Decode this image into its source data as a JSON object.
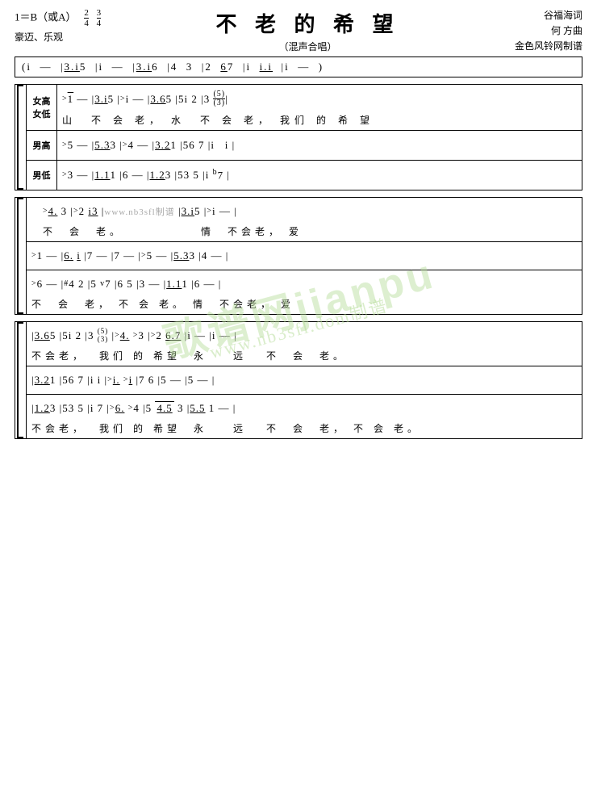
{
  "title": "不 老 的 希 望",
  "subtitle": "（混声合唱）",
  "key": "1＝B（或A）",
  "time": "2/4",
  "time2": "3/4",
  "style": "豪迈、乐观",
  "composer": {
    "lyrics": "谷福海词",
    "music": "何 方曲",
    "notation": "金色风铃网制谱"
  },
  "watermark": "歌谱网jianpu.cn",
  "watermark2": "www.nb3sfl.dom制谱",
  "intro": "(i  —  |3.i5  |i  —  |3.i6  |4  3  |2  67  |i  i.i  |i  —  )",
  "sections": {
    "s1": {
      "parts": [
        {
          "label1": "女高",
          "label2": "女低",
          "notes": ">1  —  |3.i5  |>i  —  |3.65  |5i  2  |3  (5/3)|",
          "lyrics": "山      不 会 老，  水      不 会 老，  我们  的  希  望"
        },
        {
          "label1": "男高",
          "label2": "",
          "notes": ">5  —  |5.33  |>4  —  |3.21  |56  7  |i      i  |",
          "lyrics": ""
        },
        {
          "label1": "男低",
          "label2": "",
          "notes": ">3  —  |1.11  |6  —  |1.23  |53  5  |i  b7  |",
          "lyrics": ""
        }
      ]
    },
    "s2": {
      "rows": [
        {
          "notes_row1": ">4.  3  |>2  i3  |www.nb3sfl.dom制谱  |3.i5  |>i  —  |",
          "lyrics_row1": "不      会      老。              情      不会老，  爱",
          "notes_row2": ">1  —  |6.  i  |7  —  |7  —  |>5  —  |5.33  |4  —  |",
          "lyrics_row2": "",
          "notes_row3": ">6  —  |#4  2  |5  v7  |6  5  |3  —  |1.11  |6  —  |",
          "lyrics_row3": "不      会      老，  不  会  老。  情      不会老，  爱"
        }
      ]
    },
    "s3": {
      "rows": [
        {
          "notes_row1": "|3.65  |5i  2  |3  (5/3)|>4.  >3  |>2  6.7  |i  —  |i  —  |",
          "lyrics_row1": "不会老，  我们  的  希望  永      远    不    会    老。",
          "notes_row2": "|3.21  |56  7  |i  i  |>i.  >i  |7  6  |5  —  |5  —  |",
          "notes_row3": "|1.23  |53  5  |i  7  |>6.  >4  |5  4.5  3  |5.5  1  —  |",
          "lyrics_row3": "不会老，  我们  的  希望  永      远    不    会    老，  不  会  老。"
        }
      ]
    }
  }
}
